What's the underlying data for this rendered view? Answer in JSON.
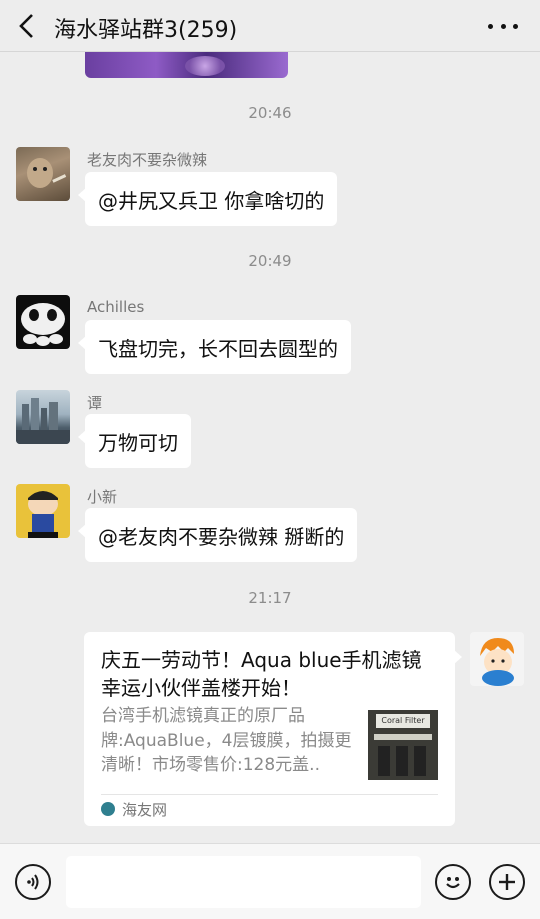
{
  "header": {
    "title": "海水驿站群3(259)"
  },
  "messages": [
    {
      "time": "20:46"
    },
    {
      "sender": "老友肉不要杂微辣",
      "text": "@井尻又兵卫  你拿啥切的"
    },
    {
      "time": "20:49"
    },
    {
      "sender": "Achilles",
      "text": "飞盘切完，长不回去圆型的"
    },
    {
      "sender": "谭",
      "text": "万物可切"
    },
    {
      "sender": "小新",
      "text": "@老友肉不要杂微辣  掰断的"
    },
    {
      "time": "21:17"
    }
  ],
  "link_card": {
    "title": "庆五一劳动节！Aqua blue手机滤镜幸运小伙伴盖楼开始！",
    "description": "台湾手机滤镜真正的原厂品牌:AquaBlue，4层镀膜，拍摄更清晰！市场零售价:128元盖..",
    "thumb_text": "Coral Filter",
    "source": "海友网"
  },
  "icons": {
    "back": "chevron-left-icon",
    "more": "more-dots-icon",
    "voice": "voice-icon",
    "emoji": "emoji-icon",
    "plus": "plus-icon"
  },
  "colors": {
    "background": "#ededed",
    "bubble": "#ffffff",
    "timestamp": "#8c8c8c"
  }
}
